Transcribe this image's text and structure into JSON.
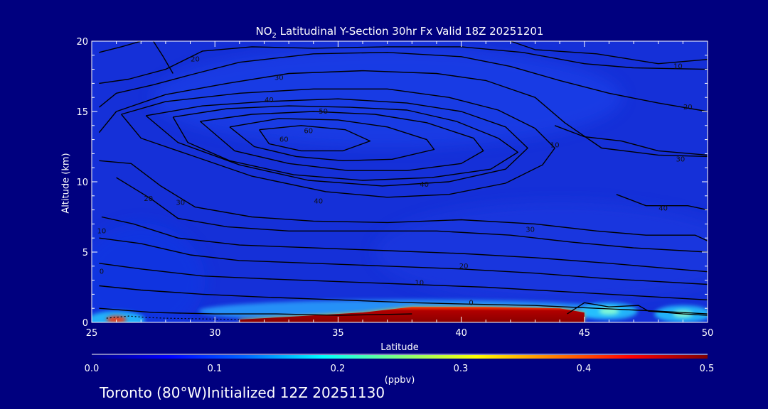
{
  "title_main": "NO",
  "title_sub": "2",
  "title_rest": " Latitudinal Y-Section 30hr  Fx Valid 18Z 20251201",
  "footer": "Toronto (80°W)Initialized 12Z 20251130",
  "colorbar": {
    "ticks": [
      "0.0",
      "0.1",
      "0.2",
      "0.3",
      "0.4",
      "0.5"
    ],
    "units": "(ppbv)",
    "colors": [
      "#00008a",
      "#0000ff",
      "#0066ff",
      "#00ffff",
      "#7fff7f",
      "#ffff00",
      "#ff7f00",
      "#ff0000",
      "#7f0000"
    ]
  },
  "chart_data": {
    "type": "heatmap",
    "title": "NO2 Latitudinal Y-Section 30hr  Fx Valid 18Z 20251201",
    "xlabel": "Latitude",
    "ylabel": "Altitude (km)",
    "xlim": [
      25,
      50
    ],
    "ylim": [
      0,
      20
    ],
    "xticks": [
      25,
      30,
      35,
      40,
      45,
      50
    ],
    "yticks": [
      0,
      5,
      10,
      15,
      20
    ],
    "color_scale": {
      "variable": "NO2",
      "units": "ppbv",
      "range": [
        0.0,
        0.5
      ]
    },
    "high_concentration_layer": {
      "description": "surface NO2 maximum",
      "lat_range": [
        31,
        45
      ],
      "top_altitude_km": [
        [
          31,
          0.2
        ],
        [
          33,
          0.4
        ],
        [
          36,
          0.7
        ],
        [
          38,
          1.1
        ],
        [
          41,
          1.1
        ],
        [
          44,
          1.0
        ],
        [
          45,
          0.7
        ]
      ],
      "value_ppbv": 0.5
    },
    "secondary_maxima": [
      {
        "lat": 26,
        "alt_km": 0.2,
        "value_ppbv": 0.45
      },
      {
        "lat": 46,
        "alt_km": 0.8,
        "value_ppbv": 0.25
      },
      {
        "lat": 49,
        "alt_km": 0.6,
        "value_ppbv": 0.2
      }
    ],
    "contour_labels": [
      {
        "text": "20",
        "lat": 29.2,
        "alt_km": 18.7
      },
      {
        "text": "30",
        "lat": 32.6,
        "alt_km": 17.4
      },
      {
        "text": "40",
        "lat": 32.2,
        "alt_km": 15.8
      },
      {
        "text": "50",
        "lat": 34.4,
        "alt_km": 15.0
      },
      {
        "text": "60",
        "lat": 33.8,
        "alt_km": 13.6
      },
      {
        "text": "60",
        "lat": 32.8,
        "alt_km": 13.0
      },
      {
        "text": "40",
        "lat": 38.5,
        "alt_km": 9.8
      },
      {
        "text": "40",
        "lat": 34.2,
        "alt_km": 8.6
      },
      {
        "text": "30",
        "lat": 28.6,
        "alt_km": 8.5
      },
      {
        "text": "20",
        "lat": 27.3,
        "alt_km": 8.8
      },
      {
        "text": "10",
        "lat": 25.4,
        "alt_km": 6.5
      },
      {
        "text": "0",
        "lat": 25.4,
        "alt_km": 3.6
      },
      {
        "text": "10",
        "lat": 43.8,
        "alt_km": 12.6
      },
      {
        "text": "30",
        "lat": 42.8,
        "alt_km": 6.6
      },
      {
        "text": "20",
        "lat": 40.1,
        "alt_km": 4.0
      },
      {
        "text": "10",
        "lat": 38.3,
        "alt_km": 2.8
      },
      {
        "text": "0",
        "lat": 40.4,
        "alt_km": 1.4
      },
      {
        "text": "10",
        "lat": 48.8,
        "alt_km": 18.2
      },
      {
        "text": "20",
        "lat": 49.2,
        "alt_km": 15.3
      },
      {
        "text": "30",
        "lat": 48.9,
        "alt_km": 11.6
      },
      {
        "text": "40",
        "lat": 48.2,
        "alt_km": 8.1
      }
    ],
    "grid": false,
    "legend": "colorbar-bottom"
  }
}
